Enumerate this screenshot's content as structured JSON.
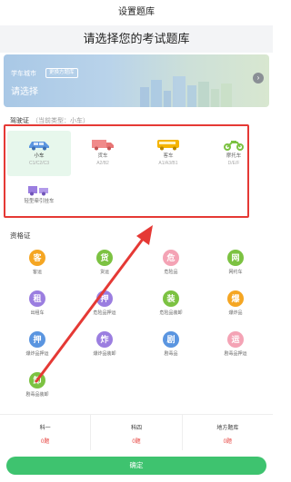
{
  "window": {
    "title": "设置题库"
  },
  "headline": "请选择您的考试题库",
  "banner": {
    "city_label": "学车城市",
    "city_tag": "更换方题库",
    "city_value": "请选择"
  },
  "license": {
    "title": "驾驶证",
    "subtitle": "（当前类型：小车）",
    "vehicles": [
      {
        "name": "小车",
        "code": "C1/C2/C3",
        "color": "#5a95e0"
      },
      {
        "name": "货车",
        "code": "A2/B2",
        "color": "#f08a8a"
      },
      {
        "name": "客车",
        "code": "A1/A3/B1",
        "color": "#f5b400"
      },
      {
        "name": "摩托车",
        "code": "D/E/F",
        "color": "#7cc242"
      },
      {
        "name": "轻型牵引挂车",
        "code": "",
        "color": "#9b7ee0"
      }
    ]
  },
  "certs": {
    "title": "资格证",
    "items": [
      {
        "glyph": "客",
        "label": "客运",
        "color": "#f5a623"
      },
      {
        "glyph": "货",
        "label": "货运",
        "color": "#7cc242"
      },
      {
        "glyph": "危",
        "label": "危险品",
        "color": "#f4a3b5"
      },
      {
        "glyph": "网",
        "label": "网约车",
        "color": "#7cc242"
      },
      {
        "glyph": "租",
        "label": "出租车",
        "color": "#9b7ee0"
      },
      {
        "glyph": "押",
        "label": "危险品押运",
        "color": "#9b7ee0"
      },
      {
        "glyph": "装",
        "label": "危险品装卸",
        "color": "#7cc242"
      },
      {
        "glyph": "爆",
        "label": "爆炸品",
        "color": "#f5a623"
      },
      {
        "glyph": "押",
        "label": "爆炸品押运",
        "color": "#5a95e0"
      },
      {
        "glyph": "炸",
        "label": "爆炸品装卸",
        "color": "#9b7ee0"
      },
      {
        "glyph": "剧",
        "label": "剧毒品",
        "color": "#5a95e0"
      },
      {
        "glyph": "运",
        "label": "剧毒品押运",
        "color": "#f4a3b5"
      },
      {
        "glyph": "卸",
        "label": "剧毒品装卸",
        "color": "#7cc242"
      }
    ]
  },
  "bottom": {
    "items": [
      {
        "label": "科一",
        "value": "0题"
      },
      {
        "label": "科四",
        "value": "0题"
      },
      {
        "label": "地方题库",
        "value": "0题"
      }
    ]
  },
  "confirm_label": "确定",
  "colors": {
    "accent": "#3ec36f",
    "highlight": "#e53935"
  }
}
